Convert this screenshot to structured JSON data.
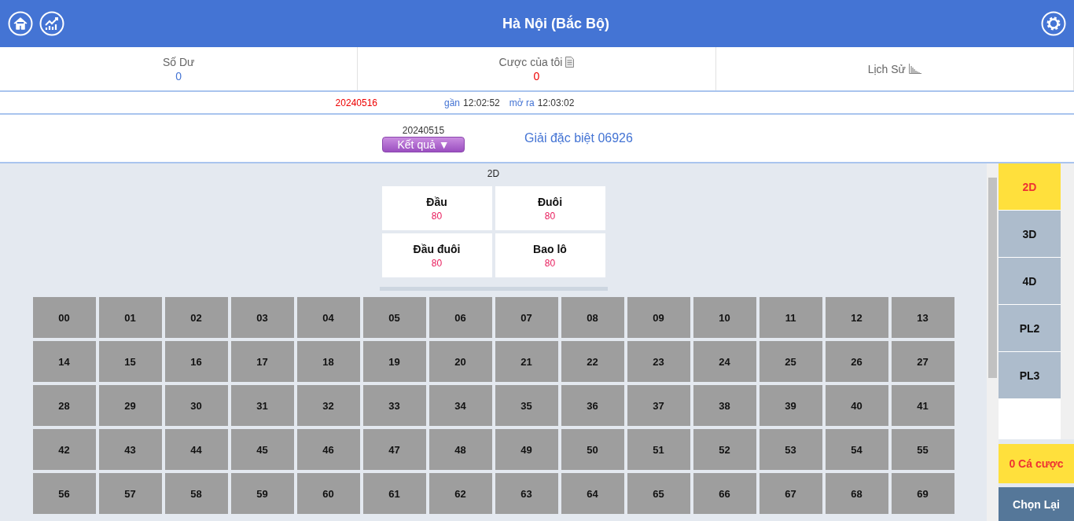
{
  "header": {
    "title": "Hà Nội (Bắc Bộ)"
  },
  "stats": [
    {
      "label": "Số Dư",
      "value": "0",
      "kind": "balance"
    },
    {
      "label": "Cược của tôi",
      "value": "0",
      "kind": "bets"
    },
    {
      "label": "Lịch Sử",
      "kind": "history"
    }
  ],
  "draw_info": {
    "current_issue": "20240516",
    "near_label": "gần",
    "near_time": "12:02:52",
    "open_label": "mở ra",
    "open_time": "12:03:02"
  },
  "last_result": {
    "issue": "20240515",
    "button": "Kết quả ▼",
    "prize": "Giải đặc biệt 06926"
  },
  "game": {
    "title": "2D",
    "bet_types": [
      {
        "name": "Đầu",
        "odds": "80",
        "selected": false
      },
      {
        "name": "Đuôi",
        "odds": "80",
        "selected": false
      },
      {
        "name": "Đầu đuôi",
        "odds": "80",
        "selected": false
      },
      {
        "name": "Bao lô",
        "odds": "80",
        "selected": false
      }
    ],
    "numbers": [
      {
        "label": "00",
        "selected": false
      },
      {
        "label": "01",
        "selected": false
      },
      {
        "label": "02",
        "selected": false
      },
      {
        "label": "03",
        "selected": false
      },
      {
        "label": "04",
        "selected": false
      },
      {
        "label": "05",
        "selected": false
      },
      {
        "label": "06",
        "selected": false
      },
      {
        "label": "07",
        "selected": false
      },
      {
        "label": "08",
        "selected": false
      },
      {
        "label": "09",
        "selected": false
      },
      {
        "label": "10",
        "selected": false
      },
      {
        "label": "11",
        "selected": false
      },
      {
        "label": "12",
        "selected": false
      },
      {
        "label": "13",
        "selected": false
      },
      {
        "label": "14",
        "selected": false
      },
      {
        "label": "15",
        "selected": false
      },
      {
        "label": "16",
        "selected": false
      },
      {
        "label": "17",
        "selected": false
      },
      {
        "label": "18",
        "selected": false
      },
      {
        "label": "19",
        "selected": false
      },
      {
        "label": "20",
        "selected": false
      },
      {
        "label": "21",
        "selected": false
      },
      {
        "label": "22",
        "selected": false
      },
      {
        "label": "23",
        "selected": false
      },
      {
        "label": "24",
        "selected": false
      },
      {
        "label": "25",
        "selected": false
      },
      {
        "label": "26",
        "selected": false
      },
      {
        "label": "27",
        "selected": false
      },
      {
        "label": "28",
        "selected": false
      },
      {
        "label": "29",
        "selected": false
      },
      {
        "label": "30",
        "selected": false
      },
      {
        "label": "31",
        "selected": false
      },
      {
        "label": "32",
        "selected": false
      },
      {
        "label": "33",
        "selected": false
      },
      {
        "label": "34",
        "selected": false
      },
      {
        "label": "35",
        "selected": false
      },
      {
        "label": "36",
        "selected": false
      },
      {
        "label": "37",
        "selected": false
      },
      {
        "label": "38",
        "selected": false
      },
      {
        "label": "39",
        "selected": false
      },
      {
        "label": "40",
        "selected": false
      },
      {
        "label": "41",
        "selected": false
      },
      {
        "label": "42",
        "selected": false
      },
      {
        "label": "43",
        "selected": false
      },
      {
        "label": "44",
        "selected": false
      },
      {
        "label": "45",
        "selected": false
      },
      {
        "label": "46",
        "selected": false
      },
      {
        "label": "47",
        "selected": false
      },
      {
        "label": "48",
        "selected": false
      },
      {
        "label": "49",
        "selected": false
      },
      {
        "label": "50",
        "selected": false
      },
      {
        "label": "51",
        "selected": false
      },
      {
        "label": "52",
        "selected": false
      },
      {
        "label": "53",
        "selected": false
      },
      {
        "label": "54",
        "selected": false
      },
      {
        "label": "55",
        "selected": false
      },
      {
        "label": "56",
        "selected": false
      },
      {
        "label": "57",
        "selected": false
      },
      {
        "label": "58",
        "selected": false
      },
      {
        "label": "59",
        "selected": false
      },
      {
        "label": "60",
        "selected": false
      },
      {
        "label": "61",
        "selected": false
      },
      {
        "label": "62",
        "selected": false
      },
      {
        "label": "63",
        "selected": false
      },
      {
        "label": "64",
        "selected": false
      },
      {
        "label": "65",
        "selected": false
      },
      {
        "label": "66",
        "selected": false
      },
      {
        "label": "67",
        "selected": false
      },
      {
        "label": "68",
        "selected": false
      },
      {
        "label": "69",
        "selected": false
      }
    ]
  },
  "game_types": [
    {
      "label": "2D",
      "selected": true
    },
    {
      "label": "3D",
      "selected": false
    },
    {
      "label": "4D",
      "selected": false
    },
    {
      "label": "PL2",
      "selected": false
    },
    {
      "label": "PL3",
      "selected": false
    }
  ],
  "bet_count": "0 Cá cược",
  "reset_button": "Chọn Lại"
}
